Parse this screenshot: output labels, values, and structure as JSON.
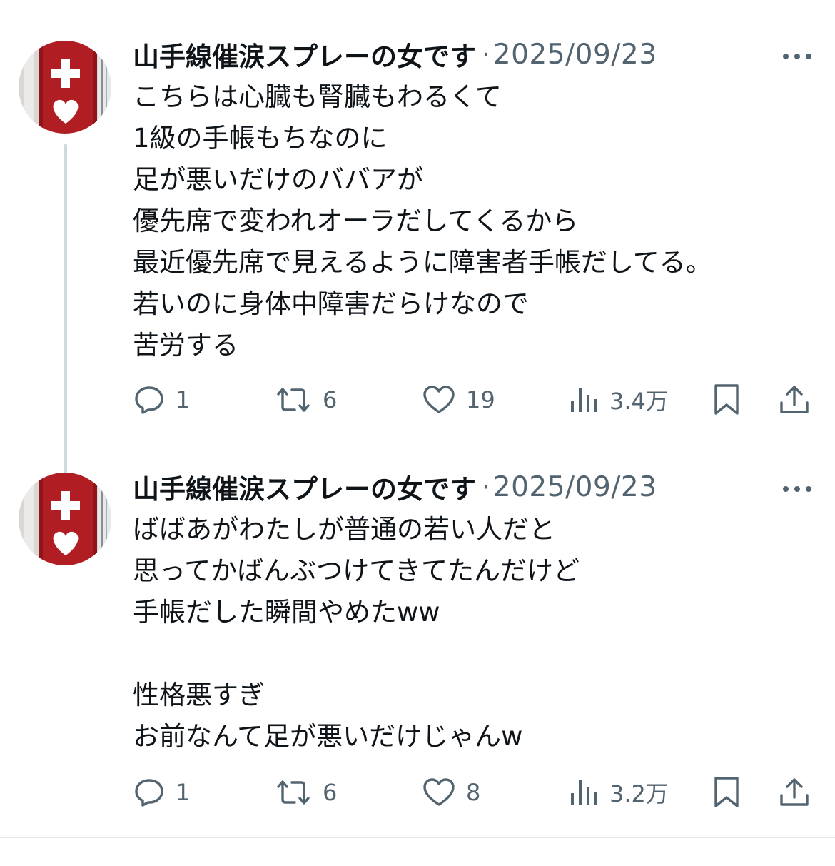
{
  "colors": {
    "text_primary": "#0f1419",
    "text_secondary": "#536471",
    "thread_line": "#cfd9de",
    "avatar_red": "#b01e23"
  },
  "tweets": [
    {
      "author": "山手線催涙スプレーの女です",
      "separator": "·",
      "date": "2025/09/23",
      "lines": [
        "こちらは心臓も腎臓もわるくて",
        "1級の手帳もちなのに",
        "足が悪いだけのババアが",
        "優先席で変われオーラだしてくるから",
        "最近優先席で見えるように障害者手帳だしてる。",
        "若いのに身体中障害だらけなので",
        "苦労する"
      ],
      "actions": {
        "reply_count": "1",
        "repost_count": "6",
        "like_count": "19",
        "views_count": "3.4万"
      }
    },
    {
      "author": "山手線催涙スプレーの女です",
      "separator": "·",
      "date": "2025/09/23",
      "lines": [
        "ばばあがわたしが普通の若い人だと",
        "思ってかばんぶつけてきてたんだけど",
        "手帳だした瞬間やめたww",
        "",
        "性格悪すぎ",
        "お前なんて足が悪いだけじゃんw"
      ],
      "actions": {
        "reply_count": "1",
        "repost_count": "6",
        "like_count": "8",
        "views_count": "3.2万"
      }
    }
  ],
  "icons": {
    "avatar": "help-mark-avatar",
    "more": "more-horizontal-icon",
    "reply": "reply-bubble-icon",
    "repost": "repost-icon",
    "like": "heart-icon",
    "views": "views-chart-icon",
    "bookmark": "bookmark-icon",
    "share": "share-icon"
  }
}
